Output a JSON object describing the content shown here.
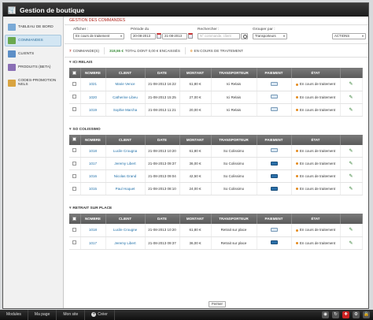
{
  "app": {
    "title": "Gestion de boutique"
  },
  "sidebar": {
    "items": [
      {
        "label": "TABLEAU DE BORD",
        "icon": "dashboard-icon",
        "color": "#7aa9d6"
      },
      {
        "label": "COMMANDES",
        "icon": "cart-icon",
        "color": "#6aa84f"
      },
      {
        "label": "CLIENTS",
        "icon": "users-icon",
        "color": "#5d8fc7"
      },
      {
        "label": "PRODUITS (BETA)",
        "icon": "box-icon",
        "color": "#8a6fb5"
      },
      {
        "label": "CODES-PROMOTIONNELS",
        "icon": "tag-icon",
        "color": "#d9a441"
      }
    ]
  },
  "page": {
    "title": "GESTION DES COMMANDES"
  },
  "filters": {
    "show_label": "Afficher :",
    "show_value": "En cours de traitement",
    "period_label": "Période du",
    "date_from": "20-08-2013",
    "date_to": "21-08-2013",
    "search_label": "Rechercher :",
    "search_placeholder": "N° commande, client",
    "group_label": "Grouper par :",
    "group_value": "Transporteurs",
    "actions_label": "ACTIONS"
  },
  "summary": {
    "orders_count": "7",
    "orders_label": "COMMANDE(S)",
    "total_amount": "318,55 €",
    "total_label": "TOTAL DONT 0,00 € ENCAISSÉS",
    "processing_count": "0",
    "processing_label": "EN COURS DE TRAITEMENT"
  },
  "columns": [
    "NOMBRE",
    "CLIENT",
    "DATE",
    "MONTANT",
    "TRANSPORTEUR",
    "PAIEMENT",
    "ÉTAT"
  ],
  "sections": [
    {
      "title": "ICI RELAIS",
      "rows": [
        {
          "number": "1021",
          "client": "Marie Vence",
          "date": "21-08-2013 16:22",
          "amount": "61,80 €",
          "carrier": "Ici Relais",
          "payment": "transfer",
          "status": "En cours de traitement"
        },
        {
          "number": "1020",
          "client": "Catherine Libeu",
          "date": "21-08-2013 15:25",
          "amount": "27,00 €",
          "carrier": "Ici Relais",
          "payment": "transfer",
          "status": "En cours de traitement"
        },
        {
          "number": "1019",
          "client": "Sophie Marcha",
          "date": "21-08-2013 11:21",
          "amount": "20,00 €",
          "carrier": "Ici Relais",
          "payment": "transfer",
          "status": "En cours de traitement"
        }
      ]
    },
    {
      "title": "SO COLISSIMO",
      "rows": [
        {
          "number": "1018",
          "client": "Lucile Crougna",
          "date": "21-08-2013 10:20",
          "amount": "61,80 €",
          "carrier": "So Colissimo",
          "payment": "transfer",
          "status": "En cours de traitement"
        },
        {
          "number": "1017",
          "client": "Jeremy Libert",
          "date": "21-08-2013 09:37",
          "amount": "36,00 €",
          "carrier": "So Colissimo",
          "payment": "card",
          "status": "En cours de traitement"
        },
        {
          "number": "1016",
          "client": "Nicolas Grand",
          "date": "21-08-2013 09:04",
          "amount": "42,50 €",
          "carrier": "So Colissimo",
          "payment": "card",
          "status": "En cours de traitement"
        },
        {
          "number": "1015",
          "client": "Paul Hoquet",
          "date": "21-08-2013 08:10",
          "amount": "24,00 €",
          "carrier": "So Colissimo",
          "payment": "card",
          "status": "En cours de traitement"
        }
      ]
    },
    {
      "title": "RETRAIT SUR PLACE",
      "rows": [
        {
          "number": "1018",
          "client": "Lucile Crougne",
          "date": "21-08-2013 10:20",
          "amount": "61,80 €",
          "carrier": "Retrait sur place",
          "payment": "transfer",
          "status": "En cours de traitement"
        },
        {
          "number": "1017",
          "client": "Jeremy Libert",
          "date": "21-08-2013 09:37",
          "amount": "36,00 €",
          "carrier": "Retrait sur place",
          "payment": "card",
          "status": "En cours de traitement"
        }
      ]
    }
  ],
  "footer": {
    "close_label": "Fermer"
  },
  "taskbar": {
    "modules": "Modules",
    "my_page": "Ma page",
    "my_site": "Mon site",
    "create": "Créer"
  },
  "colors": {
    "accent_red": "#b0241c",
    "link_blue": "#1f6fa8",
    "status_orange": "#e48b1f",
    "header_grey": "#6a6a6a"
  }
}
